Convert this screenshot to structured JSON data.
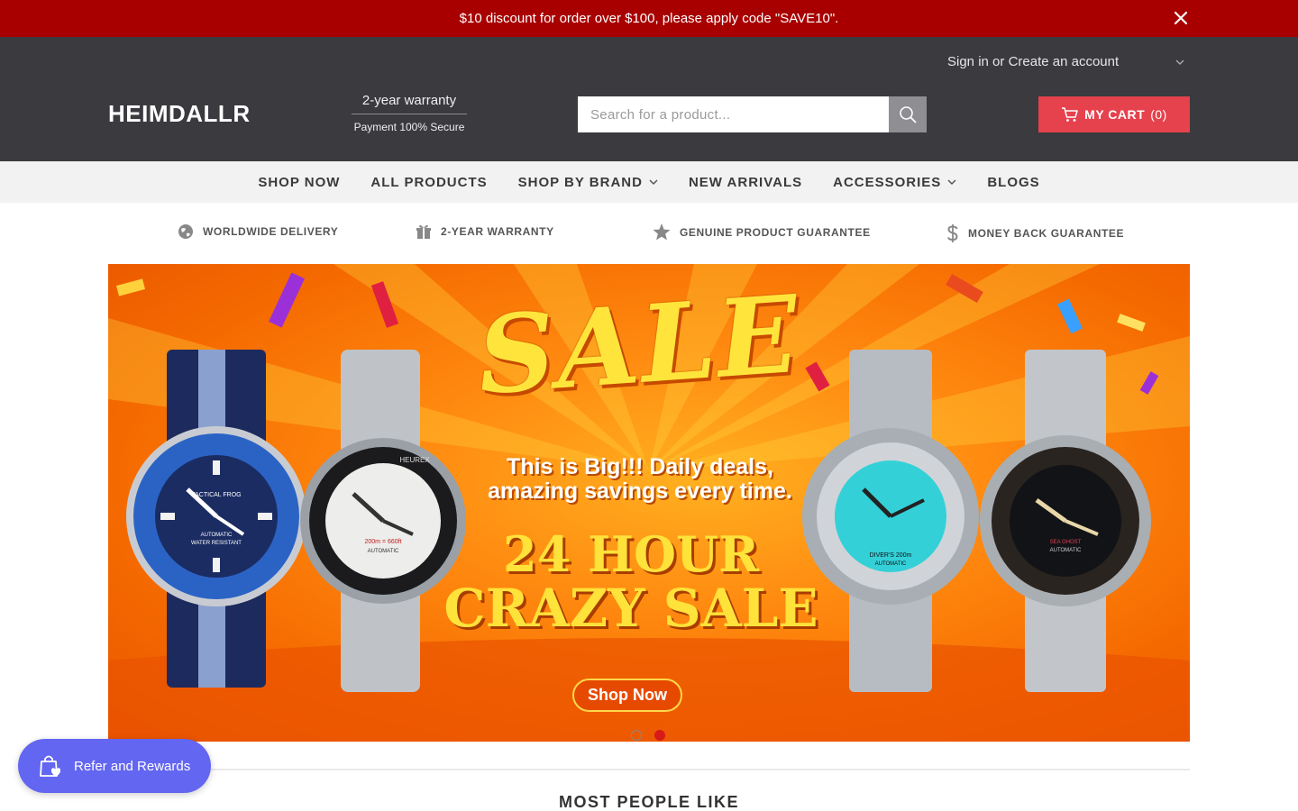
{
  "announcement": {
    "text": "$10 discount for order over $100, please apply code \"SAVE10\"."
  },
  "header": {
    "account": {
      "sign_in": "Sign in",
      "or": "or",
      "create": "Create an account"
    },
    "logo": "HEIMDALLR",
    "warranty": {
      "line1": "2-year warranty",
      "line2": "Payment 100% Secure"
    },
    "search": {
      "placeholder": "Search for a product..."
    },
    "cart": {
      "label": "MY CART",
      "count": "(0)"
    }
  },
  "nav": {
    "items": [
      {
        "label": "SHOP NOW"
      },
      {
        "label": "ALL PRODUCTS"
      },
      {
        "label": "SHOP BY BRAND"
      },
      {
        "label": "NEW ARRIVALS"
      },
      {
        "label": "ACCESSORIES"
      },
      {
        "label": "BLOGS"
      }
    ]
  },
  "features": [
    {
      "label": "WORLDWIDE DELIVERY",
      "icon": "globe-icon"
    },
    {
      "label": "2-YEAR WARRANTY",
      "icon": "gift-icon"
    },
    {
      "label": "GENUINE PRODUCT GUARANTEE",
      "icon": "star-icon"
    },
    {
      "label": "MONEY BACK GUARANTEE",
      "icon": "dollar-icon"
    }
  ],
  "banner": {
    "sale": "SALE",
    "tagline_line1": "This is Big!!! Daily deals,",
    "tagline_line2": "amazing savings every time.",
    "headline1": "24 HOUR",
    "headline2": "CRAZY SALE",
    "button": "Shop Now",
    "watches": [
      {
        "dial_text1": "TACTICAL FROG",
        "dial_text2": "AUTOMATIC",
        "dial_text3": "WATER RESISTANT"
      },
      {
        "dial_text1": "200m = 660ft",
        "dial_text2": "AUTOMATIC",
        "bezel_text": "HEUREX"
      },
      {
        "dial_text1": "DIVER'S 200m",
        "dial_text2": "AUTOMATIC"
      },
      {
        "dial_text1": "SEA GHOST",
        "dial_text2": "AUTOMATIC"
      }
    ]
  },
  "section": {
    "title": "MOST PEOPLE LIKE"
  },
  "rewards": {
    "label": "Refer and Rewards"
  },
  "colors": {
    "announce": "#a80000",
    "header": "#3a3a3f",
    "cart": "#e5424d",
    "rewards": "#6366f1",
    "active_dot": "#d71a1a"
  }
}
